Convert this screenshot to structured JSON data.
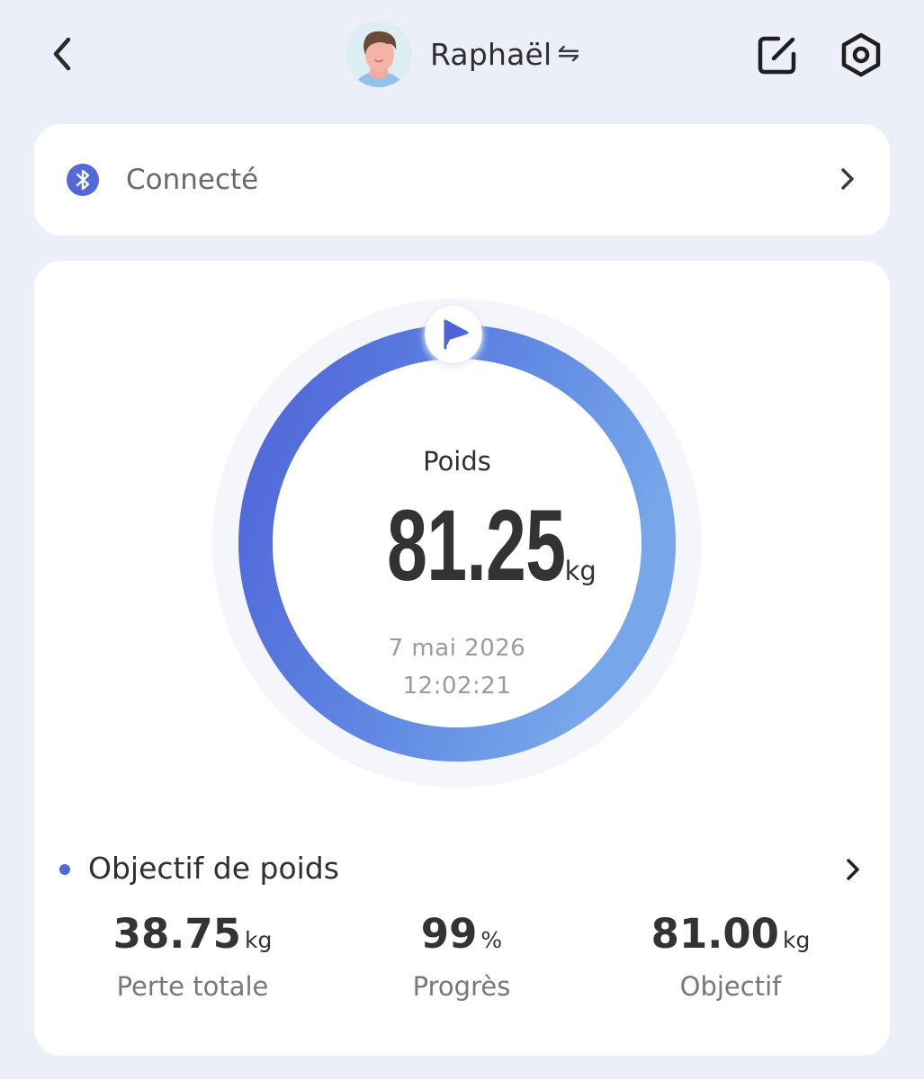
{
  "header": {
    "back_icon": "chevron-left-icon",
    "profile_name": "Raphaël",
    "swap_icon": "⇋",
    "edit_icon": "edit-square-icon",
    "settings_icon": "hexagon-gear-icon"
  },
  "connection": {
    "icon": "bluetooth-icon",
    "label": "Connecté",
    "chevron_icon": "chevron-right-icon"
  },
  "weight": {
    "label": "Poids",
    "value": "81.25",
    "unit": "kg",
    "date": "7 mai 2026",
    "time": "12:02:21",
    "flag_icon": "flag-icon"
  },
  "goal": {
    "title": "Objectif de poids",
    "chevron_icon": "chevron-right-icon",
    "stats": [
      {
        "value": "38.75",
        "unit": "kg",
        "label": "Perte totale"
      },
      {
        "value": "99",
        "unit": "%",
        "label": "Progrès"
      },
      {
        "value": "81.00",
        "unit": "kg",
        "label": "Objectif"
      }
    ]
  },
  "colors": {
    "background": "#ECEFFA",
    "accent": "#5468D9",
    "ring_start": "#4F63D8",
    "ring_end": "#77A6EA"
  }
}
